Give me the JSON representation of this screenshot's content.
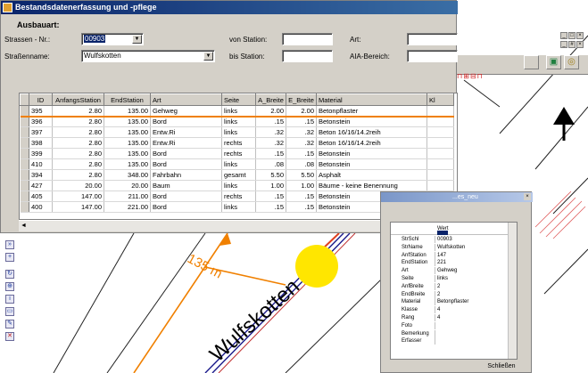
{
  "dialog": {
    "title": "Bestandsdatenerfassung und -pflege",
    "heading": "Ausbauart:",
    "strassen_nr_label": "Strassen - Nr.:",
    "strassen_nr_value": "00903",
    "strassenname_label": "Straßenname:",
    "strassenname_value": "Wulfskotten",
    "von_station_label": "von Station:",
    "bis_station_label": "bis Station:",
    "art_label": "Art:",
    "aia_label": "AIA-Bereich:"
  },
  "grid": {
    "columns": [
      "ID",
      "AnfangsStation",
      "EndStation",
      "Art",
      "Seite",
      "A_Breite",
      "E_Breite",
      "Material",
      "Kl"
    ],
    "rows": [
      [
        "395",
        "2.80",
        "135.00",
        "Gehweg",
        "links",
        "2.00",
        "2.00",
        "Betonpflaster"
      ],
      [
        "396",
        "2.80",
        "135.00",
        "Bord",
        "links",
        ".15",
        ".15",
        "Betonstein"
      ],
      [
        "397",
        "2.80",
        "135.00",
        "Entw.Ri",
        "links",
        ".32",
        ".32",
        "Beton 16/16/14.2reih"
      ],
      [
        "398",
        "2.80",
        "135.00",
        "Entw.Ri",
        "rechts",
        ".32",
        ".32",
        "Beton 16/16/14.2reih"
      ],
      [
        "399",
        "2.80",
        "135.00",
        "Bord",
        "rechts",
        ".15",
        ".15",
        "Betonstein"
      ],
      [
        "410",
        "2.80",
        "135.00",
        "Bord",
        "links",
        ".08",
        ".08",
        "Betonstein"
      ],
      [
        "394",
        "2.80",
        "348.00",
        "Fahrbahn",
        "gesamt",
        "5.50",
        "5.50",
        "Asphalt"
      ],
      [
        "427",
        "20.00",
        "20.00",
        "Baum",
        "links",
        "1.00",
        "1.00",
        "Bäume - keine Benennung"
      ],
      [
        "405",
        "147.00",
        "211.00",
        "Bord",
        "rechts",
        ".15",
        ".15",
        "Betonstein"
      ],
      [
        "400",
        "147.00",
        "221.00",
        "Bord",
        "links",
        ".15",
        ".15",
        "Betonstein"
      ]
    ]
  },
  "map": {
    "distance_label": "135 m",
    "street_label_1": "Wulfskotten",
    "street_label_2": "ulfskotten"
  },
  "attributes": {
    "title": "...es_neu",
    "value_header": "Wert",
    "rows": [
      [
        "StrSchl",
        "00903"
      ],
      [
        "StrName",
        "Wulfskotten"
      ],
      [
        "AnfStation",
        "147"
      ],
      [
        "EndStation",
        "221"
      ],
      [
        "Art",
        "Gehweg"
      ],
      [
        "Seite",
        "links"
      ],
      [
        "AnfBreite",
        "2"
      ],
      [
        "EndBreite",
        "2"
      ],
      [
        "Material",
        "Betonpflaster"
      ],
      [
        "Klasse",
        "4"
      ],
      [
        "Rang",
        "4"
      ],
      [
        "Foto",
        ""
      ],
      [
        "Bemerkung",
        ""
      ],
      [
        "Erfasser",
        ""
      ]
    ],
    "close_label": "Schließen"
  },
  "colors": {
    "title_bar": "#0a246a",
    "selection_line": "#f08000",
    "highlight_circle": "#ffe600",
    "road_line": "#1a1a8a"
  }
}
